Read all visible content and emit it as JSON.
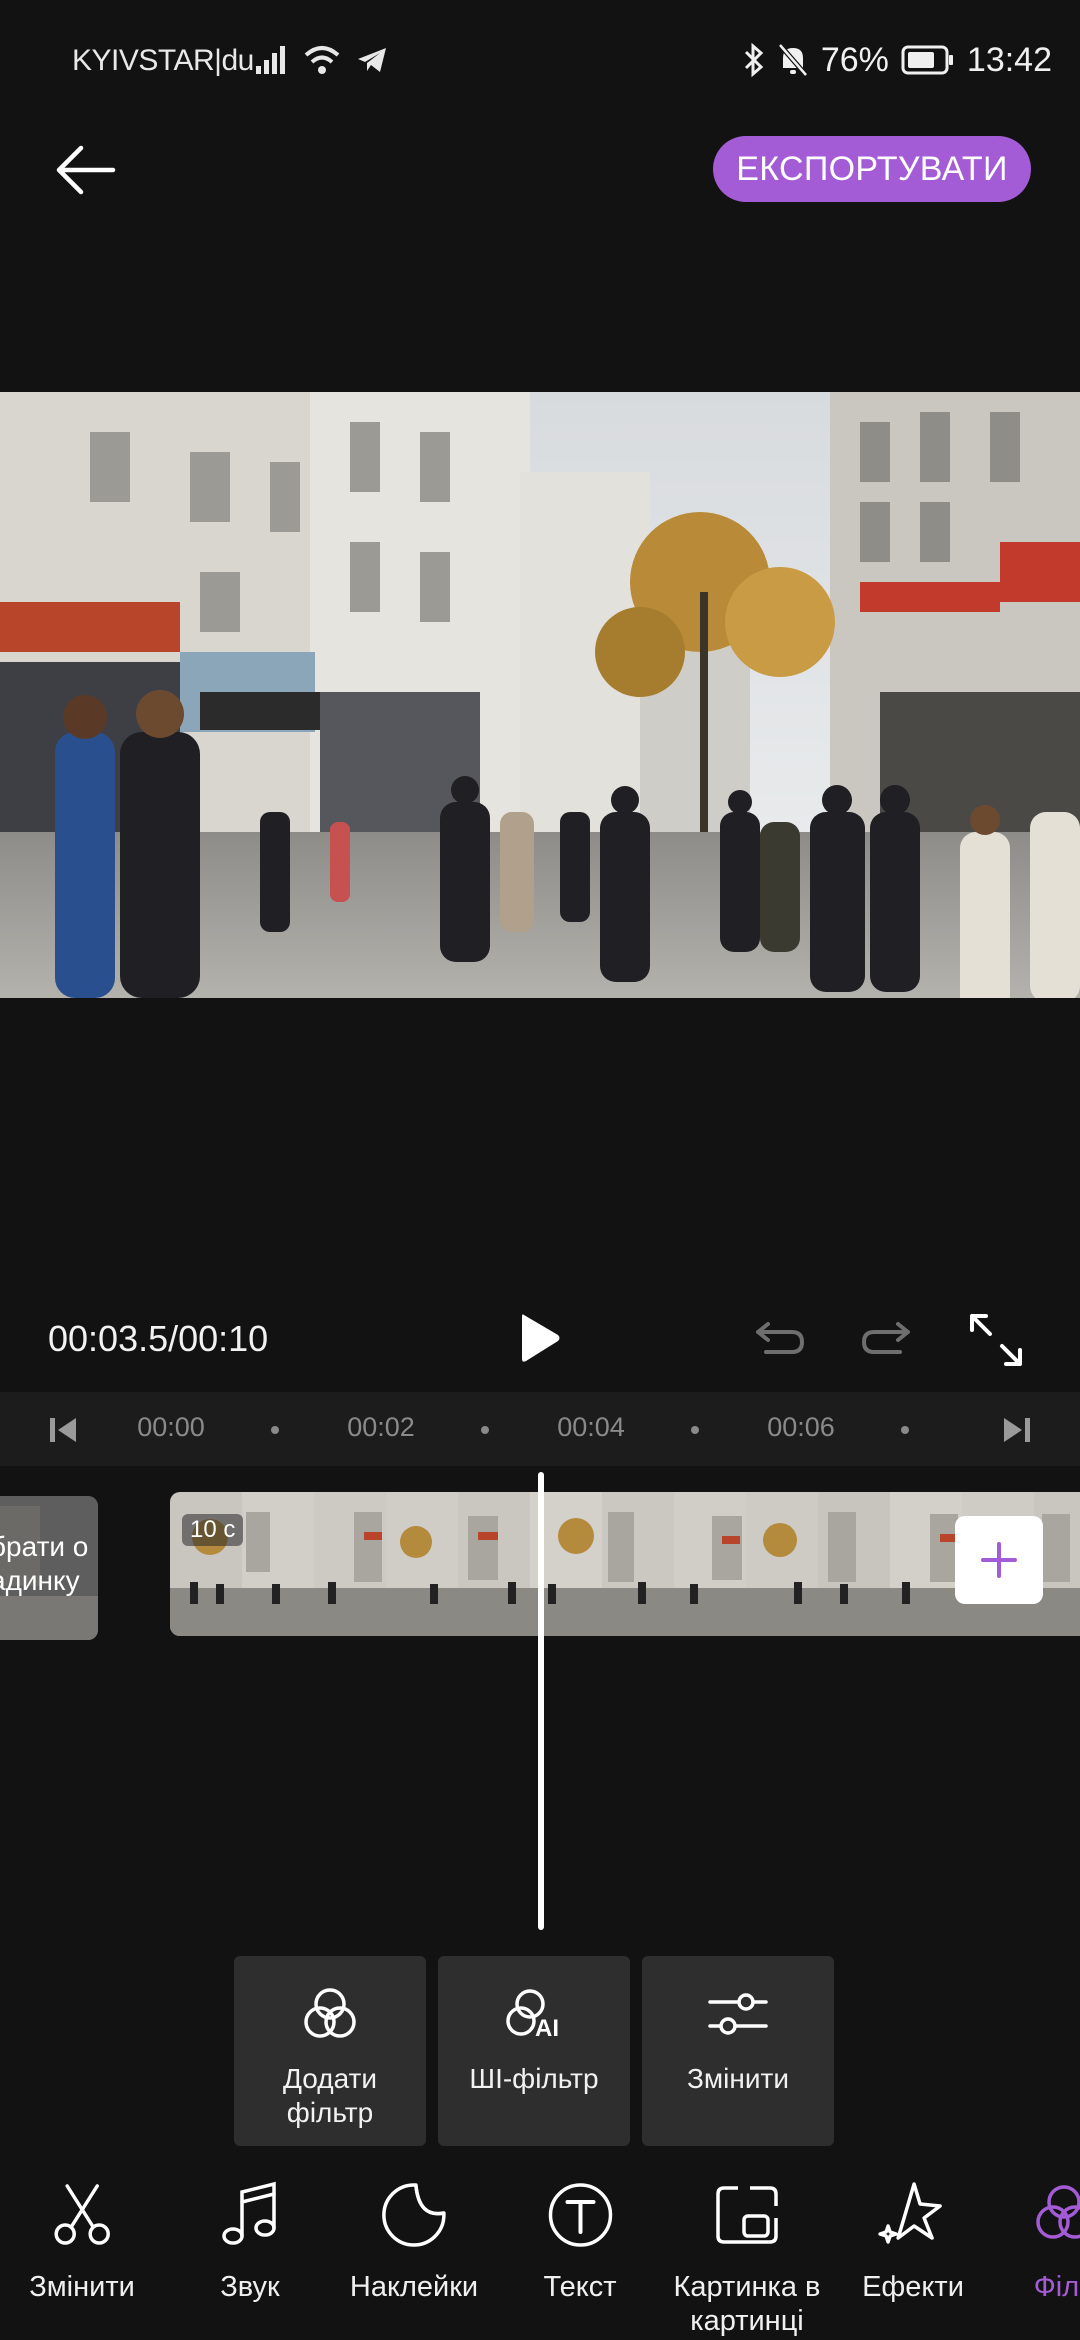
{
  "status_bar": {
    "carrier": "KYIVSTAR|du",
    "battery_percent": "76%",
    "time": "13:42"
  },
  "header": {
    "export_label": "ЕКСПОРТУВАТИ"
  },
  "playback": {
    "current_time": "00:03.5",
    "total_time": "00:10",
    "timecode": "00:03.5/00:10"
  },
  "ruler": {
    "ticks": [
      "00:00",
      "00:02",
      "00:04",
      "00:06"
    ]
  },
  "timeline": {
    "cover_label_line1": "брати о",
    "cover_label_line2": "адинку",
    "clip_duration": "10 с"
  },
  "filter_tools": [
    {
      "label": "Додати фільтр",
      "icon": "add-filter-icon"
    },
    {
      "label": "ШІ-фільтр",
      "icon": "ai-filter-icon"
    },
    {
      "label": "Змінити",
      "icon": "adjust-sliders-icon"
    }
  ],
  "bottom_nav": [
    {
      "label": "Змінити",
      "icon": "scissors-icon"
    },
    {
      "label": "Звук",
      "icon": "music-note-icon"
    },
    {
      "label": "Наклейки",
      "icon": "sticker-icon"
    },
    {
      "label": "Текст",
      "icon": "text-icon"
    },
    {
      "label": "Картинка в картинці",
      "icon": "picture-in-picture-icon"
    },
    {
      "label": "Ефекти",
      "icon": "effects-star-icon"
    },
    {
      "label": "Філь",
      "icon": "filter-icon"
    }
  ],
  "colors": {
    "accent": "#a45bd6",
    "background": "#121212",
    "card": "#2e2e2e"
  }
}
